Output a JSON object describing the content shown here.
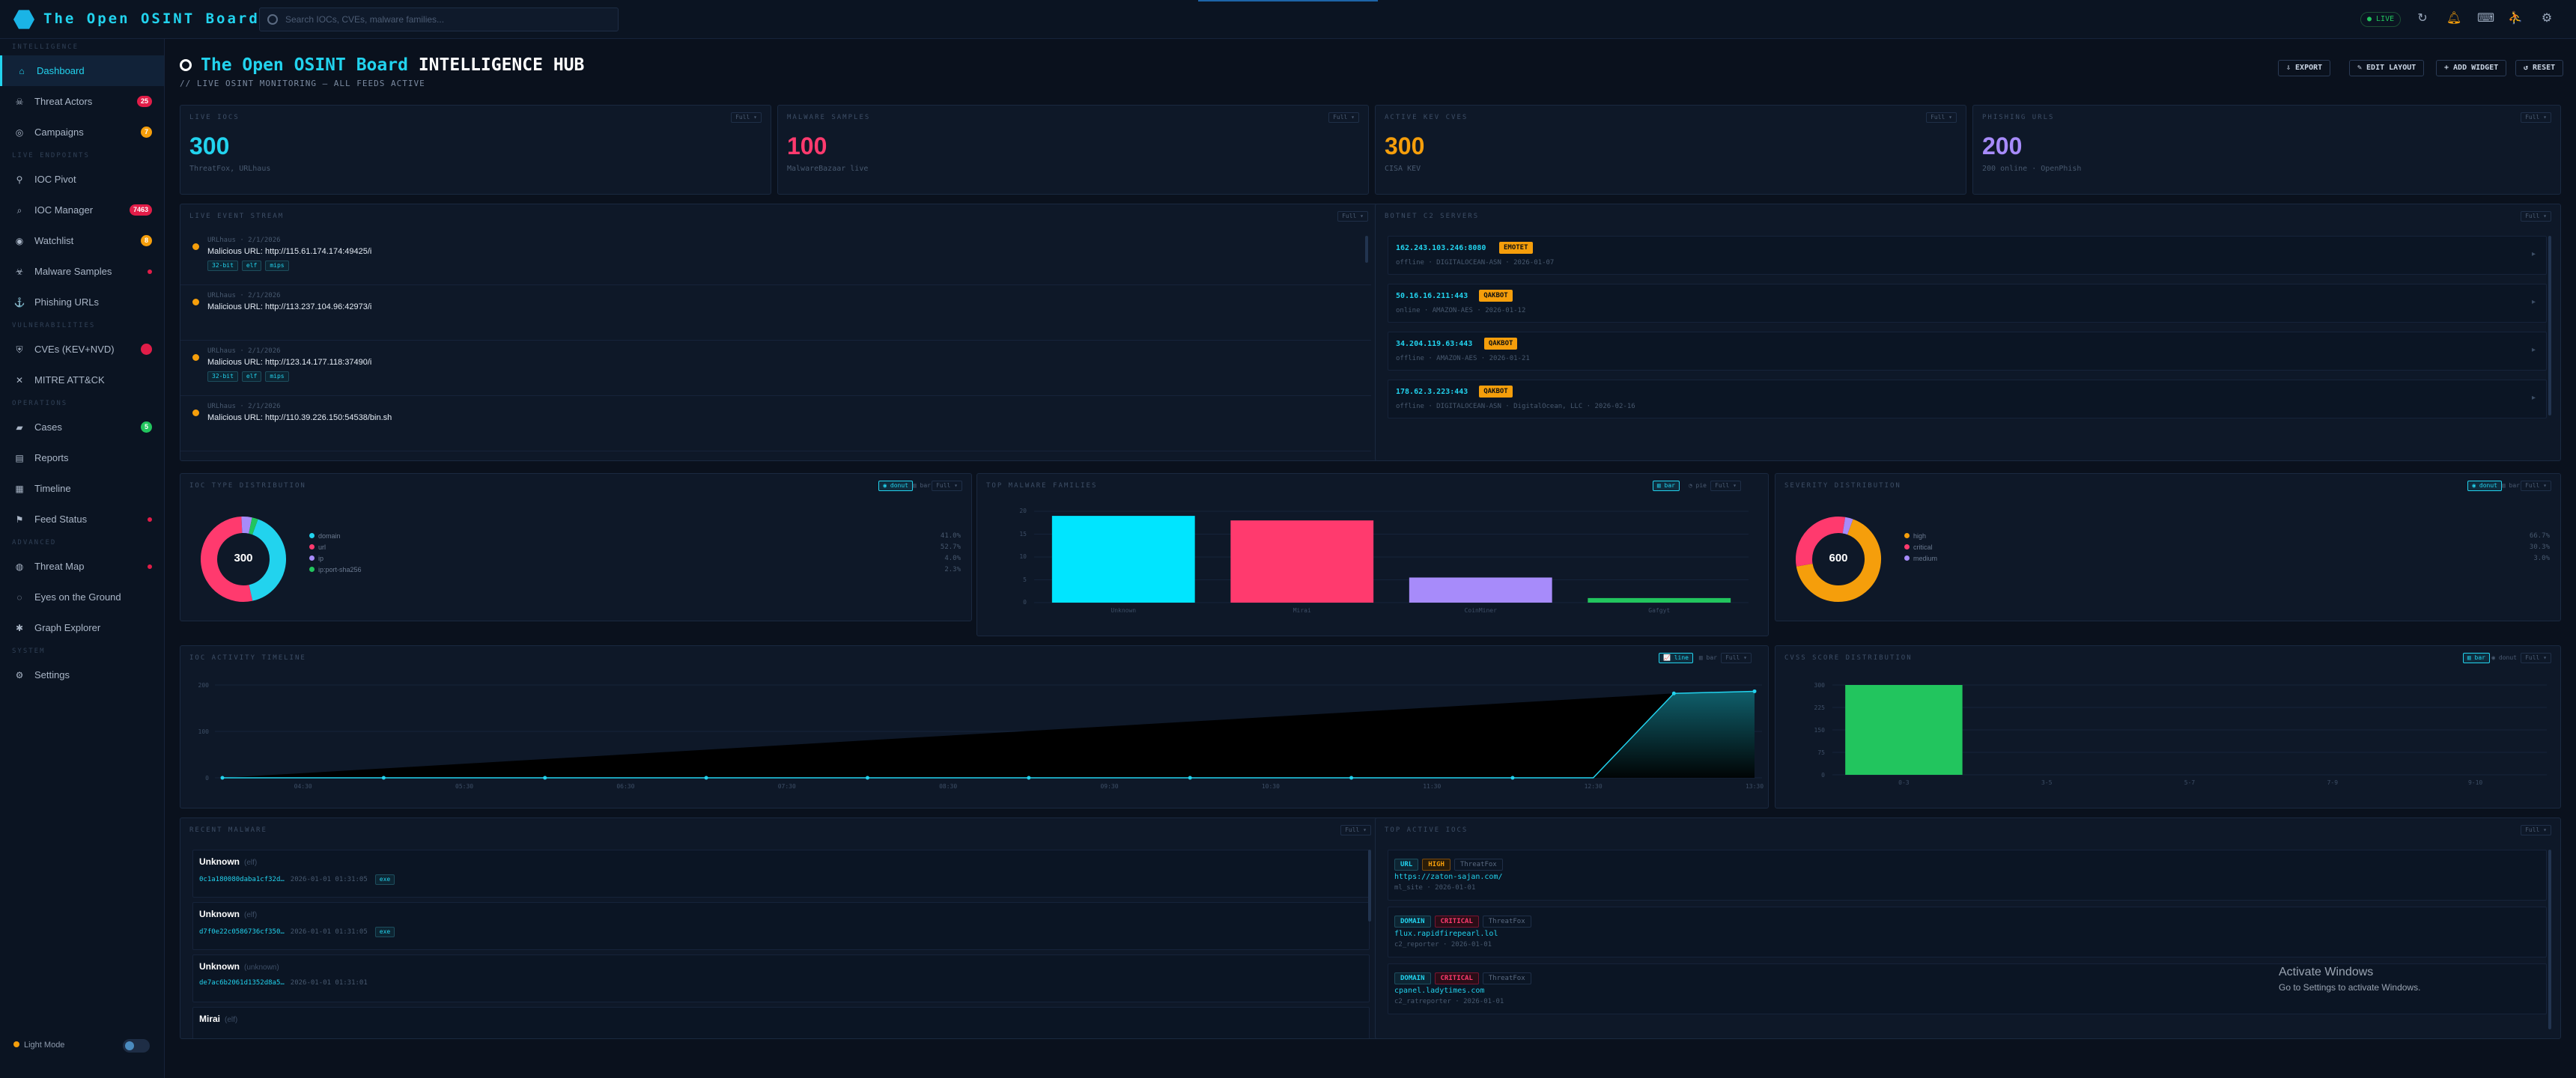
{
  "app": {
    "title": "The Open OSINT Board",
    "search_placeholder": "Search IOCs, CVEs, malware families...",
    "live": "● LIVE"
  },
  "colors": {
    "accent": "#22d3ee",
    "pink": "#ff3a6e",
    "orange": "#f59e0b",
    "purple": "#a78bfa",
    "green": "#22c55e"
  },
  "sidebar": {
    "sections": [
      "INTELLIGENCE",
      "LIVE ENDPOINTS",
      "VULNERABILITIES",
      "OPERATIONS",
      "ADVANCED",
      "SYSTEM"
    ],
    "items": [
      {
        "label": "Dashboard",
        "icon": "home-icon",
        "glyph": "⌂"
      },
      {
        "label": "Threat Actors",
        "icon": "actor-icon",
        "glyph": "☠",
        "badge": "25",
        "badge_color": "#e11d48"
      },
      {
        "label": "Campaigns",
        "icon": "target-icon",
        "glyph": "◎",
        "badge": "7",
        "badge_color": "#f59e0b"
      },
      {
        "label": "IOC Pivot",
        "icon": "pivot-icon",
        "glyph": "⚲"
      },
      {
        "label": "IOC Manager",
        "icon": "search-icon",
        "glyph": "⌕",
        "badge": "7463",
        "badge_color": "#e11d48"
      },
      {
        "label": "Watchlist",
        "icon": "eye-icon",
        "glyph": "◉",
        "badge": "8",
        "badge_color": "#f59e0b"
      },
      {
        "label": "Malware Samples",
        "icon": "biohazard-icon",
        "glyph": "☣",
        "dot": true
      },
      {
        "label": "Phishing URLs",
        "icon": "hook-icon",
        "glyph": "⚓"
      },
      {
        "label": "CVEs (KEV+NVD)",
        "icon": "shield-icon",
        "glyph": "⛨",
        "badge": "",
        "badge_color": "#e11d48"
      },
      {
        "label": "MITRE ATT&CK",
        "icon": "crossed-swords-icon",
        "glyph": "✕"
      },
      {
        "label": "Cases",
        "icon": "folder-icon",
        "glyph": "▰",
        "badge": "5",
        "badge_color": "#22c55e"
      },
      {
        "label": "Reports",
        "icon": "document-icon",
        "glyph": "▤"
      },
      {
        "label": "Timeline",
        "icon": "calendar-icon",
        "glyph": "▦"
      },
      {
        "label": "Feed Status",
        "icon": "antenna-icon",
        "glyph": "⚑",
        "dot": true
      },
      {
        "label": "Threat Map",
        "icon": "globe-icon",
        "glyph": "◍",
        "dot": true
      },
      {
        "label": "Eyes on the Ground",
        "icon": "eye-icon",
        "glyph": "◌"
      },
      {
        "label": "Graph Explorer",
        "icon": "graph-icon",
        "glyph": "✱"
      },
      {
        "label": "Settings",
        "icon": "gear-icon",
        "glyph": "⚙"
      }
    ],
    "light_mode": "Light Mode"
  },
  "header": {
    "title_accent": "The Open OSINT Board",
    "title_rest": "INTELLIGENCE HUB",
    "subtitle": "// LIVE OSINT MONITORING — ALL FEEDS ACTIVE",
    "buttons": [
      "⇩ EXPORT",
      "✎ EDIT LAYOUT",
      "+ ADD WIDGET",
      "↺ RESET"
    ]
  },
  "kpis": [
    {
      "title": "LIVE IOCS",
      "value": "300",
      "sub": "ThreatFox, URLhaus",
      "color": "#22d3ee",
      "ctl": "Full ▾"
    },
    {
      "title": "MALWARE SAMPLES",
      "value": "100",
      "sub": "MalwareBazaar live",
      "color": "#ff3a6e",
      "ctl": "Full ▾"
    },
    {
      "title": "ACTIVE KEV CVES",
      "value": "300",
      "sub": "CISA KEV",
      "color": "#f59e0b",
      "ctl": "Full ▾"
    },
    {
      "title": "PHISHING URLS",
      "value": "200",
      "sub": "200 online · OpenPhish",
      "color": "#a78bfa",
      "ctl": "Full ▾"
    }
  ],
  "events": {
    "title": "LIVE EVENT STREAM",
    "ctl": "Full ▾",
    "items": [
      {
        "src": "URLhaus · 2/1/2026",
        "msg": "Malicious URL: http://115.61.174.174:49425/i",
        "tags": [
          "32-bit",
          "elf",
          "mips"
        ]
      },
      {
        "src": "URLhaus · 2/1/2026",
        "msg": "Malicious URL: http://113.237.104.96:42973/i",
        "tags": []
      },
      {
        "src": "URLhaus · 2/1/2026",
        "msg": "Malicious URL: http://123.14.177.118:37490/i",
        "tags": [
          "32-bit",
          "elf",
          "mips"
        ]
      },
      {
        "src": "URLhaus · 2/1/2026",
        "msg": "Malicious URL: http://110.39.226.150:54538/bin.sh",
        "tags": []
      }
    ]
  },
  "c2": {
    "title": "BOTNET C2 SERVERS",
    "ctl": "Full ▾",
    "items": [
      {
        "ip": "162.243.103.246:8080",
        "fam": "EMOTET",
        "meta": "offline · DIGITALOCEAN-ASN · 2026-01-07"
      },
      {
        "ip": "50.16.16.211:443",
        "fam": "QAKBOT",
        "meta": "online · AMAZON-AES · 2026-01-12"
      },
      {
        "ip": "34.204.119.63:443",
        "fam": "QAKBOT",
        "meta": "offline · AMAZON-AES · 2026-01-21"
      },
      {
        "ip": "178.62.3.223:443",
        "fam": "QAKBOT",
        "meta": "offline · DIGITALOCEAN-ASN · DigitalOcean, LLC · 2026-02-16"
      }
    ]
  },
  "ioc_types": {
    "title": "IOC TYPE DISTRIBUTION",
    "ctls": [
      "◉ donut",
      "▥ bar",
      "Full ▾"
    ],
    "total": "300",
    "legend": [
      {
        "label": "domain",
        "value": "41.0%",
        "color": "#22d3ee"
      },
      {
        "label": "url",
        "value": "52.7%",
        "color": "#ff3a6e"
      },
      {
        "label": "ip",
        "value": "4.0%",
        "color": "#a78bfa"
      },
      {
        "label": "ip:port-sha256",
        "value": "2.3%",
        "color": "#22c55e"
      }
    ]
  },
  "families": {
    "title": "TOP MALWARE FAMILIES",
    "ctls": [
      "▥ bar",
      "◔ pie",
      "Full ▾"
    ],
    "ylabels": [
      "20",
      "15",
      "10",
      "5",
      "0"
    ]
  },
  "severity": {
    "title": "SEVERITY DISTRIBUTION",
    "ctls": [
      "◉ donut",
      "▥ bar",
      "Full ▾"
    ],
    "total": "600",
    "legend": [
      {
        "label": "high",
        "value": "66.7%",
        "color": "#f59e0b"
      },
      {
        "label": "critical",
        "value": "30.3%",
        "color": "#ff3a6e"
      },
      {
        "label": "medium",
        "value": "3.0%",
        "color": "#a78bfa"
      }
    ]
  },
  "activity": {
    "title": "IOC ACTIVITY TIMELINE",
    "ctls": [
      "📈 line",
      "▥ bar",
      "Full ▾"
    ],
    "ylabels": [
      "200",
      "100",
      "0"
    ],
    "xlabels": [
      "04:30",
      "05:30",
      "06:30",
      "07:30",
      "08:30",
      "09:30",
      "10:30",
      "11:30",
      "12:30",
      "13:30"
    ]
  },
  "cvss": {
    "title": "CVSS SCORE DISTRIBUTION",
    "ctls": [
      "▥ bar",
      "◉ donut",
      "Full ▾"
    ],
    "ylabels": [
      "300",
      "225",
      "150",
      "75",
      "0"
    ],
    "xlabels": [
      "0-3",
      "3-5",
      "5-7",
      "7-9",
      "9-10"
    ]
  },
  "recent_malware": {
    "title": "RECENT MALWARE",
    "ctl": "Full ▾",
    "items": [
      {
        "name": "Unknown",
        "ftype": "(elf)",
        "hash": "0c1a180080daba1cf32d…",
        "date": "2026-01-01 01:31:05",
        "tag": "exe"
      },
      {
        "name": "Unknown",
        "ftype": "(elf)",
        "hash": "d7f0e22c0586736cf350…",
        "date": "2026-01-01 01:31:05",
        "tag": "exe"
      },
      {
        "name": "Unknown",
        "ftype": "(unknown)",
        "hash": "de7ac6b2061d1352d8a5…",
        "date": "2026-01-01 01:31:01",
        "tag": ""
      },
      {
        "name": "Mirai",
        "ftype": "(elf)",
        "hash": "",
        "date": "",
        "tag": ""
      }
    ]
  },
  "top_iocs": {
    "title": "TOP ACTIVE IOCS",
    "ctl": "Full ▾",
    "items": [
      {
        "type": "URL",
        "sev": "HIGH",
        "src": "ThreatFox",
        "value": "https://zaton-sajan.com/",
        "meta": "ml_site · 2026-01-01"
      },
      {
        "type": "DOMAIN",
        "sev": "CRITICAL",
        "src": "ThreatFox",
        "value": "flux.rapidfirepearl.lol",
        "meta": "c2_reporter · 2026-01-01"
      },
      {
        "type": "DOMAIN",
        "sev": "CRITICAL",
        "src": "ThreatFox",
        "value": "cpanel.ladytimes.com",
        "meta": "c2_ratreporter · 2026-01-01"
      }
    ]
  },
  "windows": {
    "line1": "Activate Windows",
    "line2": "Go to Settings to activate Windows."
  },
  "chart_data": [
    {
      "type": "pie",
      "title": "IOC TYPE DISTRIBUTION",
      "categories": [
        "domain",
        "url",
        "ip",
        "ip:port-sha256"
      ],
      "values": [
        41.0,
        52.7,
        4.0,
        2.3
      ],
      "colors": [
        "#22d3ee",
        "#ff3a6e",
        "#a78bfa",
        "#22c55e"
      ]
    },
    {
      "type": "bar",
      "title": "TOP MALWARE FAMILIES",
      "categories": [
        "Unknown",
        "Mirai",
        "CoinMiner",
        "Gafgyt"
      ],
      "values": [
        19,
        18,
        5.5,
        1
      ],
      "colors": [
        "#00e5ff",
        "#ff3a6e",
        "#a78bfa",
        "#22c55e"
      ],
      "ylim": [
        0,
        20
      ]
    },
    {
      "type": "pie",
      "title": "SEVERITY DISTRIBUTION",
      "categories": [
        "high",
        "critical",
        "medium"
      ],
      "values": [
        66.7,
        30.3,
        3.0
      ],
      "colors": [
        "#f59e0b",
        "#ff3a6e",
        "#a78bfa"
      ]
    },
    {
      "type": "area",
      "title": "IOC ACTIVITY TIMELINE",
      "x": [
        "04:00",
        "04:30",
        "05:00",
        "05:30",
        "06:00",
        "06:30",
        "07:00",
        "07:30",
        "08:00",
        "08:30",
        "09:00",
        "09:30",
        "10:00",
        "10:30",
        "11:00",
        "11:30",
        "12:00",
        "12:30",
        "13:00",
        "13:30"
      ],
      "values": [
        0,
        0,
        0,
        0,
        0,
        0,
        0,
        0,
        0,
        0,
        0,
        0,
        0,
        0,
        0,
        0,
        0,
        0,
        200,
        205
      ],
      "ylim": [
        0,
        220
      ]
    },
    {
      "type": "bar",
      "title": "CVSS SCORE DISTRIBUTION",
      "categories": [
        "0-3",
        "3-5",
        "5-7",
        "7-9",
        "9-10"
      ],
      "values": [
        300,
        0,
        0,
        0,
        0
      ],
      "colors": [
        "#22c55e"
      ],
      "ylim": [
        0,
        300
      ]
    }
  ]
}
